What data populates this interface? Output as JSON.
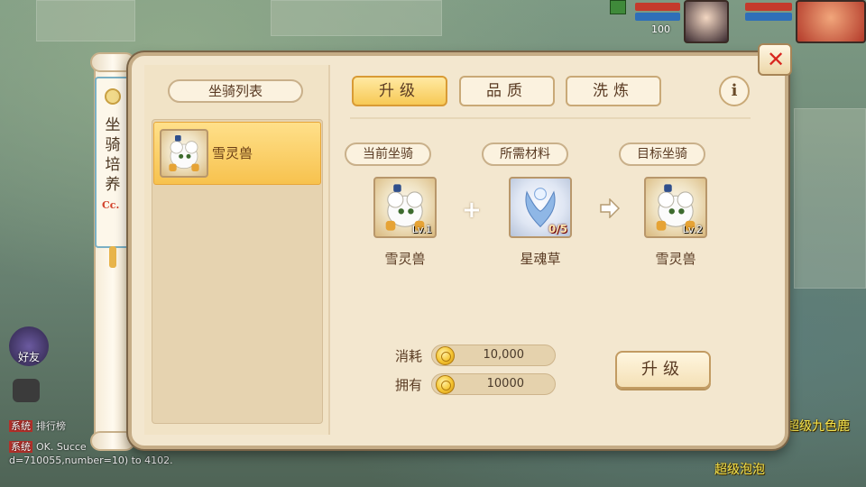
{
  "hud": {
    "level_number": "100"
  },
  "chat": {
    "lines": [
      {
        "tag": "系统",
        "text": "排行榜"
      },
      {
        "tag": "系统",
        "text": "OK. Succe"
      },
      {
        "tag": "",
        "text": "d=710055,number=10) to 4102."
      }
    ],
    "friends_label": "好友"
  },
  "scene": {
    "npc_names": [
      "超级九色鹿",
      "超级泡泡"
    ]
  },
  "scroll": {
    "title": "坐骑培养",
    "mark": "Cc."
  },
  "left_panel": {
    "title": "坐骑列表",
    "mounts": [
      {
        "name": "雪灵兽",
        "selected": true
      }
    ]
  },
  "tabs": [
    {
      "label": "升级",
      "active": true
    },
    {
      "label": "品质",
      "active": false
    },
    {
      "label": "洗炼",
      "active": false
    }
  ],
  "info_label": "i",
  "close_label": "✕",
  "slots": {
    "current": {
      "title": "当前坐骑",
      "name": "雪灵兽",
      "level": "Lv.1"
    },
    "material": {
      "title": "所需材料",
      "name": "星魂草",
      "count": "0/5"
    },
    "target": {
      "title": "目标坐骑",
      "name": "雪灵兽",
      "level": "Lv.2"
    }
  },
  "cost": {
    "consume_label": "消耗",
    "consume_value": "10,000",
    "own_label": "拥有",
    "own_value": "10000"
  },
  "upgrade_button": "升级",
  "colors": {
    "accent": "#f7c24e",
    "panel": "#f3e7cf",
    "close": "#d8261f"
  }
}
